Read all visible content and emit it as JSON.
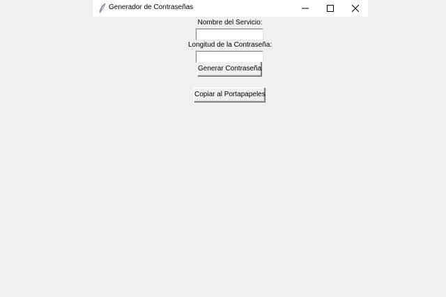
{
  "window": {
    "title": "Generador de Contraseñas",
    "icon": "feather-icon",
    "controls": [
      "minimize-icon",
      "maximize-icon",
      "close-icon"
    ]
  },
  "form": {
    "service_label": "Nombre del Servicio:",
    "service_value": "",
    "length_label": "Longitud de la Contraseña:",
    "length_value": "",
    "generate_button": "Generar Contraseña",
    "copy_button": "Copiar al Portapapeles"
  },
  "colors": {
    "background": "#f0f0f0",
    "titlebar": "#ffffff",
    "input_background": "#ffffff"
  }
}
